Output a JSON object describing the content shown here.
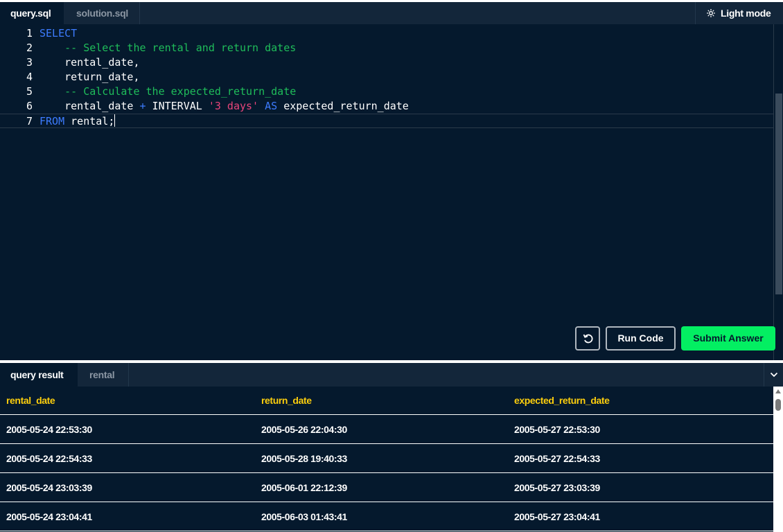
{
  "editor": {
    "tabs": [
      {
        "label": "query.sql",
        "active": true
      },
      {
        "label": "solution.sql",
        "active": false
      }
    ],
    "light_mode_label": "Light mode",
    "lines": [
      {
        "num": "1",
        "tokens": [
          {
            "t": "SELECT",
            "c": "kw"
          }
        ]
      },
      {
        "num": "2",
        "tokens": [
          {
            "t": "    "
          },
          {
            "t": "-- Select the rental and return dates",
            "c": "cm"
          }
        ]
      },
      {
        "num": "3",
        "tokens": [
          {
            "t": "    rental_date,"
          }
        ]
      },
      {
        "num": "4",
        "tokens": [
          {
            "t": "    return_date,"
          }
        ]
      },
      {
        "num": "5",
        "tokens": [
          {
            "t": "    "
          },
          {
            "t": "-- Calculate the expected_return_date",
            "c": "cm"
          }
        ]
      },
      {
        "num": "6",
        "tokens": [
          {
            "t": "    rental_date "
          },
          {
            "t": "+",
            "c": "op"
          },
          {
            "t": " INTERVAL "
          },
          {
            "t": "'3 days'",
            "c": "str"
          },
          {
            "t": " "
          },
          {
            "t": "AS",
            "c": "kw"
          },
          {
            "t": " expected_return_date"
          }
        ]
      },
      {
        "num": "7",
        "tokens": [
          {
            "t": "FROM",
            "c": "kw"
          },
          {
            "t": " rental;"
          }
        ]
      }
    ],
    "buttons": {
      "run_label": "Run Code",
      "submit_label": "Submit Answer"
    }
  },
  "results": {
    "tabs": [
      {
        "label": "query result",
        "active": true
      },
      {
        "label": "rental",
        "active": false
      }
    ],
    "columns": [
      "rental_date",
      "return_date",
      "expected_return_date"
    ],
    "rows": [
      [
        "2005-05-24 22:53:30",
        "2005-05-26 22:04:30",
        "2005-05-27 22:53:30"
      ],
      [
        "2005-05-24 22:54:33",
        "2005-05-28 19:40:33",
        "2005-05-27 22:54:33"
      ],
      [
        "2005-05-24 23:03:39",
        "2005-06-01 22:12:39",
        "2005-05-27 23:03:39"
      ],
      [
        "2005-05-24 23:04:41",
        "2005-06-03 01:43:41",
        "2005-05-27 23:04:41"
      ]
    ]
  },
  "colors": {
    "background": "#05192d",
    "keyword": "#3d7cff",
    "comment": "#1fbd5a",
    "string": "#e8457a",
    "header_text": "#fcce0d",
    "submit": "#03ef62"
  }
}
